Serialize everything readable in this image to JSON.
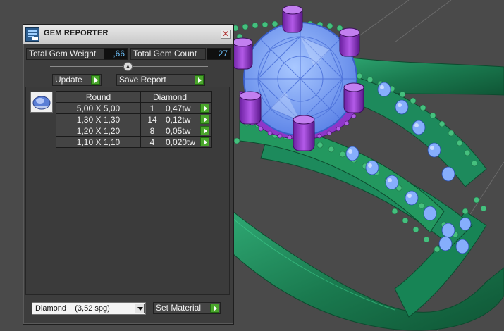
{
  "panel": {
    "title": "GEM REPORTER",
    "close_glyph": "✕",
    "total_weight_label": "Total Gem Weight",
    "total_weight_value": ",66",
    "total_count_label": "Total Gem Count",
    "total_count_value": "27",
    "update_label": "Update",
    "save_report_label": "Save Report",
    "table": {
      "headers": [
        "Round",
        "Diamond"
      ],
      "rows": [
        {
          "size": "5,00 X 5,00",
          "count": "1",
          "weight": "0,47tw"
        },
        {
          "size": "1,30 X 1,30",
          "count": "14",
          "weight": "0,12tw"
        },
        {
          "size": "1,20 X 1,20",
          "count": "8",
          "weight": "0,05tw"
        },
        {
          "size": "1,10 X 1,10",
          "count": "4",
          "weight": "0,020tw"
        }
      ]
    },
    "material_select": "Diamond    (3,52 spg)",
    "set_material_label": "Set Material"
  },
  "icons": {
    "app": "gem-reporter-app-icon",
    "close": "close-icon",
    "collapse": "collapse-chevron-icon",
    "go": "green-arrow-icon",
    "gem_thumb": "round-gem-icon",
    "dropdown": "dropdown-arrow-icon"
  },
  "colors": {
    "metal": "#1f8c5a",
    "gem": "#7fb0ff",
    "prong": "#8a2fc4",
    "viewport_bg": "#4a4a4a",
    "value_text": "#6fc4ff",
    "go_button": "#4aa62c"
  }
}
